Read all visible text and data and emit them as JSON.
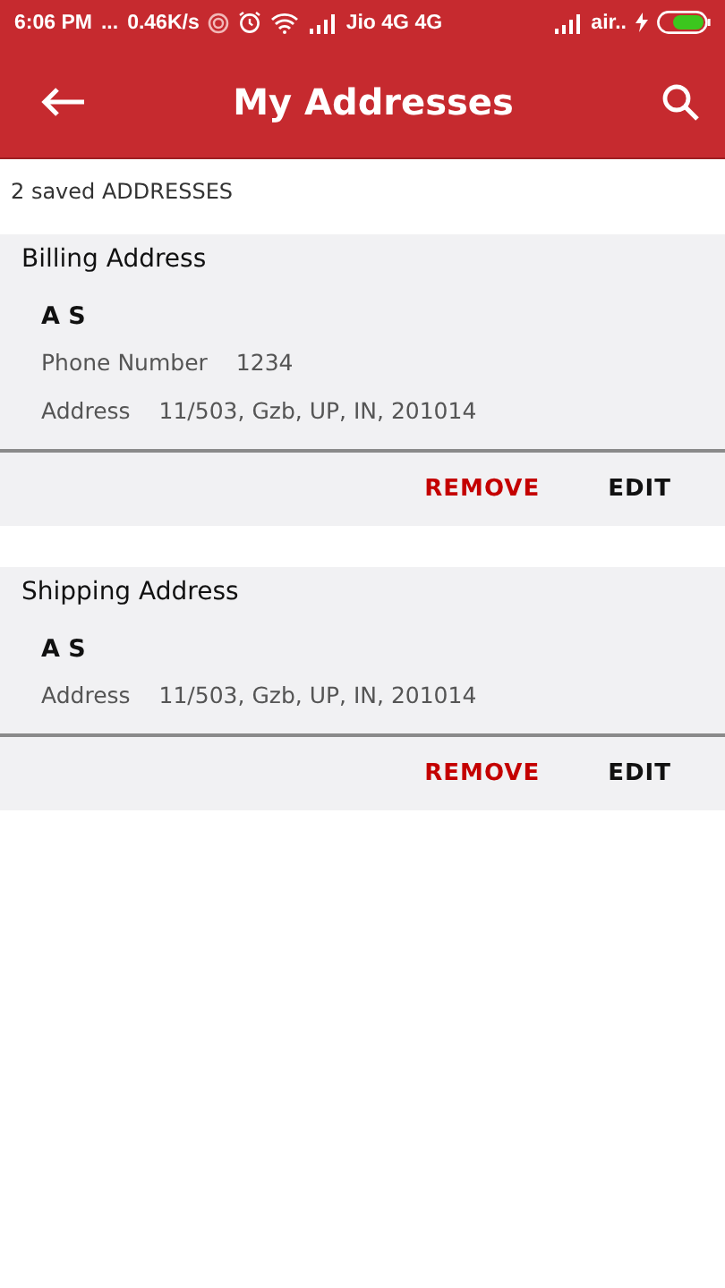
{
  "status_bar": {
    "time": "6:06 PM",
    "dots": "...",
    "speed": "0.46K/s",
    "carrier_1": "Jio 4G 4G",
    "carrier_2": "air.."
  },
  "app_bar": {
    "title": "My Addresses"
  },
  "count_label": "2 saved ADDRESSES",
  "addresses": [
    {
      "title": "Billing Address",
      "name": "A S",
      "fields": [
        {
          "label": "Phone Number",
          "value": "1234"
        },
        {
          "label": "Address",
          "value": "11/503, Gzb, UP, IN, 201014"
        }
      ],
      "actions": [
        {
          "kind": "danger",
          "label": "REMOVE"
        },
        {
          "kind": "plain",
          "label": "EDIT"
        }
      ]
    },
    {
      "title": "Shipping Address",
      "name": "A S",
      "fields": [
        {
          "label": "Address",
          "value": "11/503, Gzb, UP, IN, 201014"
        }
      ],
      "actions": [
        {
          "kind": "danger",
          "label": "REMOVE"
        },
        {
          "kind": "plain",
          "label": "EDIT"
        }
      ]
    }
  ]
}
